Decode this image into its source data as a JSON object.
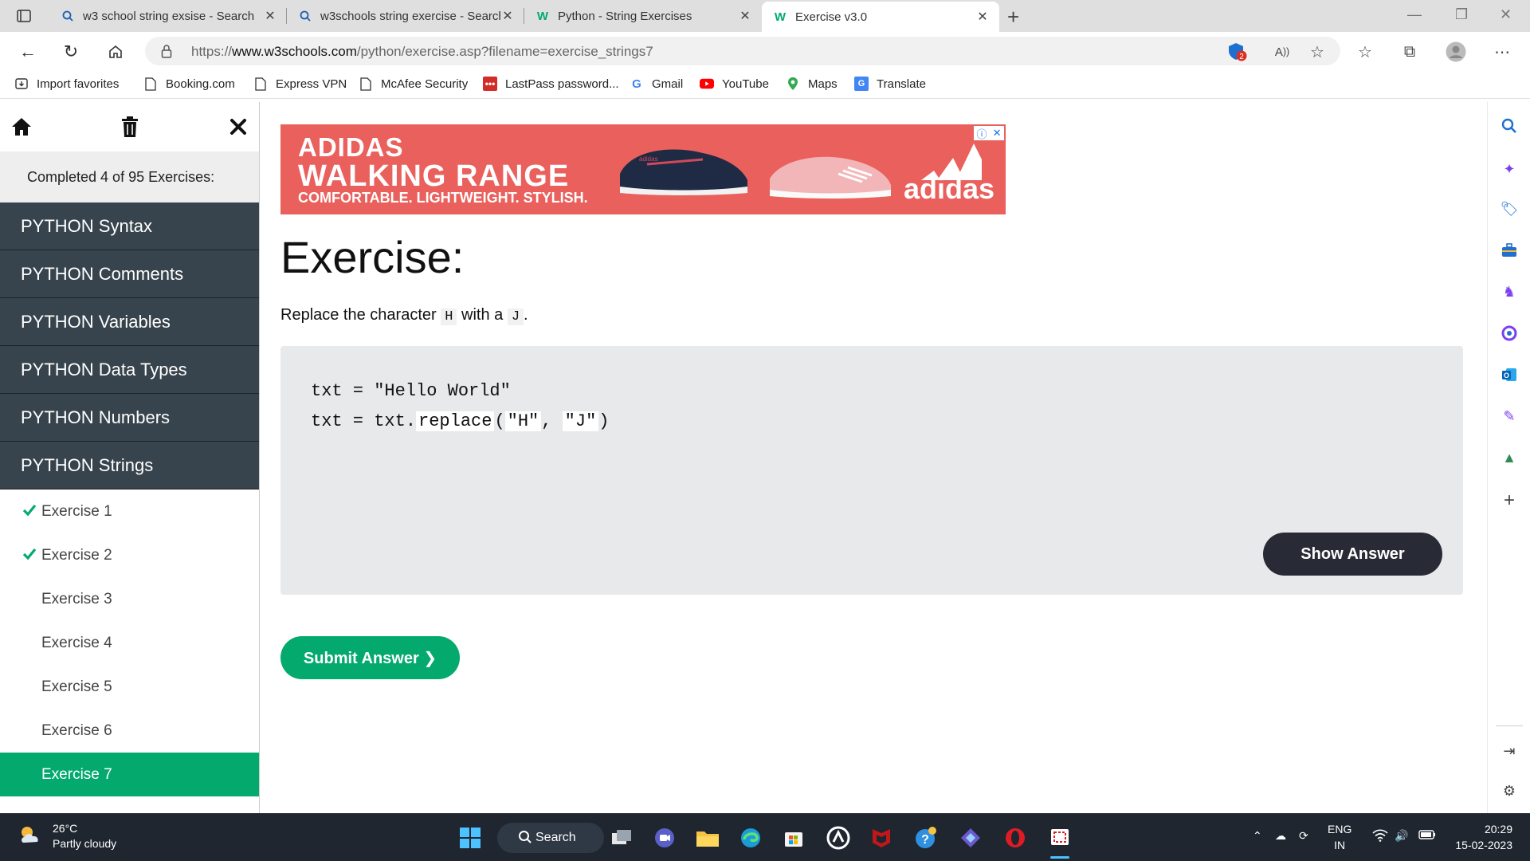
{
  "browser": {
    "tabs": [
      {
        "label": "w3 school string exsise - Search",
        "icon": "search-icon"
      },
      {
        "label": "w3schools string exercise - Search",
        "icon": "search-icon"
      },
      {
        "label": "Python - String Exercises",
        "icon": "w3schools-icon"
      },
      {
        "label": "Exercise v3.0",
        "icon": "w3schools-icon"
      }
    ],
    "url_prefix": "https://",
    "url_domain": "www.w3schools.com",
    "url_path": "/python/exercise.asp?filename=exercise_strings7",
    "tracker_badge": "2",
    "favorites": [
      {
        "label": "Import favorites",
        "icon": "import-icon"
      },
      {
        "label": "Booking.com",
        "icon": "page-icon"
      },
      {
        "label": "Express VPN",
        "icon": "page-icon"
      },
      {
        "label": "McAfee Security",
        "icon": "page-icon"
      },
      {
        "label": "LastPass password...",
        "icon": "lastpass-icon"
      },
      {
        "label": "Gmail",
        "icon": "google-icon"
      },
      {
        "label": "YouTube",
        "icon": "youtube-icon"
      },
      {
        "label": "Maps",
        "icon": "maps-icon"
      },
      {
        "label": "Translate",
        "icon": "translate-icon"
      }
    ]
  },
  "sidebar": {
    "completed": "Completed 4 of 95 Exercises:",
    "categories": [
      "PYTHON Syntax",
      "PYTHON Comments",
      "PYTHON Variables",
      "PYTHON Data Types",
      "PYTHON Numbers",
      "PYTHON Strings"
    ],
    "exercises": [
      {
        "label": "Exercise 1",
        "done": true
      },
      {
        "label": "Exercise 2",
        "done": true
      },
      {
        "label": "Exercise 3",
        "done": false
      },
      {
        "label": "Exercise 4",
        "done": false
      },
      {
        "label": "Exercise 5",
        "done": false
      },
      {
        "label": "Exercise 6",
        "done": false
      },
      {
        "label": "Exercise 7",
        "done": false,
        "active": true
      }
    ]
  },
  "ad": {
    "line1": "ADIDAS",
    "line2": "WALKING RANGE",
    "line3": "COMFORTABLE. LIGHTWEIGHT. STYLISH.",
    "brand": "adidas",
    "shoe_label": "adidas"
  },
  "exercise": {
    "heading": "Exercise:",
    "instr_pre": "Replace the character",
    "instr_char1": "H",
    "instr_mid": "with a",
    "instr_char2": "J",
    "instr_post": ".",
    "code_line1": "txt = \"Hello World\"",
    "code_line2_a": "txt = txt.",
    "code_field1": "replace",
    "code_line2_b": "(",
    "code_field2": "\"H\"",
    "code_line2_c": ", ",
    "code_field3": "\"J\"",
    "code_line2_d": ")",
    "show_answer": "Show Answer",
    "submit": "Submit Answer ❯"
  },
  "taskbar": {
    "temp": "26°C",
    "weather": "Partly cloudy",
    "search": "Search",
    "lang1": "ENG",
    "lang2": "IN",
    "time": "20:29",
    "date": "15-02-2023"
  },
  "colors": {
    "w3_green": "#04aa6d",
    "sidebar_dark": "#38444d",
    "button_dark": "#282a35",
    "ad_red": "#e9605c"
  }
}
